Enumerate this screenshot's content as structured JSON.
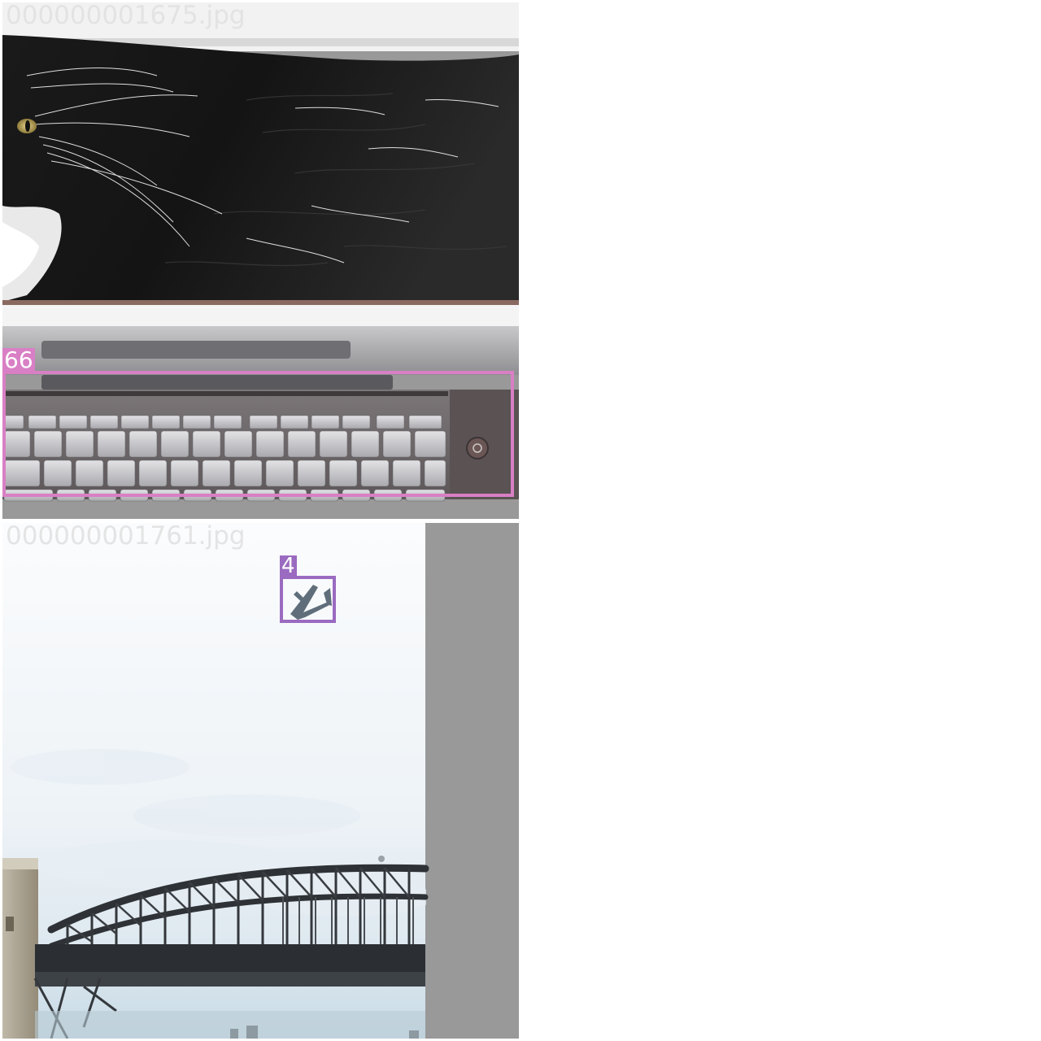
{
  "tiles": [
    {
      "filename": "000000001675.jpg",
      "detections": [
        {
          "label": "66",
          "color": "#d97fc5",
          "object": "laptop"
        }
      ]
    },
    {
      "filename": "000000001761.jpg",
      "detections": [
        {
          "label": "4",
          "color": "#9a6bc0",
          "object": "airplane"
        }
      ]
    }
  ],
  "colors": {
    "padding": "#999999",
    "background": "#ffffff"
  }
}
